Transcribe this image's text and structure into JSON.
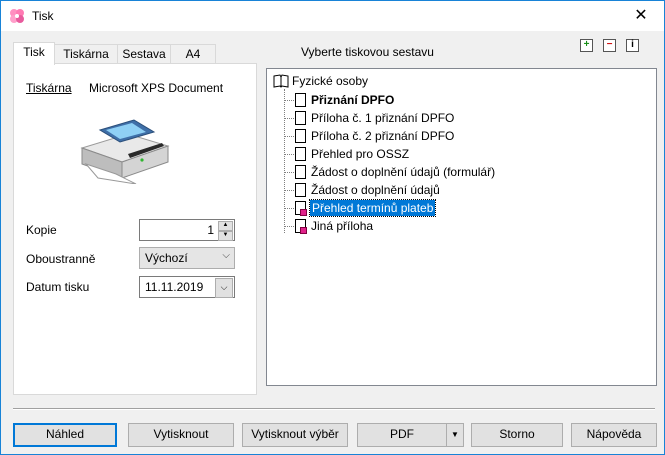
{
  "window": {
    "title": "Tisk",
    "close_glyph": "✕"
  },
  "tabs": [
    {
      "label": "Tisk",
      "active": true
    },
    {
      "label": "Tiskárna",
      "active": false
    },
    {
      "label": "Sestava",
      "active": false
    },
    {
      "label": "A4",
      "active": false
    }
  ],
  "print_panel": {
    "printer_label": "Tiskárna",
    "printer_name": "Microsoft XPS Document",
    "copies_label": "Kopie",
    "copies_value": "1",
    "duplex_label": "Oboustranně",
    "duplex_value": "Výchozí",
    "date_label": "Datum tisku",
    "date_value": "11.11.2019"
  },
  "report": {
    "title": "Vyberte tiskovou sestavu",
    "toolbar": [
      "add-icon",
      "remove-icon",
      "info-icon"
    ],
    "root": "Fyzické osoby",
    "items": [
      {
        "label": "Přiznání DPFO",
        "bold": true,
        "icon": "document-icon",
        "selected": false
      },
      {
        "label": "Příloha č. 1 přiznání DPFO",
        "bold": false,
        "icon": "document-icon",
        "selected": false
      },
      {
        "label": "Příloha č. 2 přiznání DPFO",
        "bold": false,
        "icon": "document-icon",
        "selected": false
      },
      {
        "label": "Přehled pro OSSZ",
        "bold": false,
        "icon": "document-icon",
        "selected": false
      },
      {
        "label": "Žádost o doplnění údajů (formulář)",
        "bold": false,
        "icon": "document-icon",
        "selected": false
      },
      {
        "label": "Žádost o doplnění údajů",
        "bold": false,
        "icon": "document-icon",
        "selected": false
      },
      {
        "label": "Přehled termínů plateb",
        "bold": false,
        "icon": "custom-document-icon",
        "selected": true
      },
      {
        "label": "Jiná příloha",
        "bold": false,
        "icon": "custom-document-icon",
        "selected": false
      }
    ]
  },
  "buttons": {
    "preview": "Náhled",
    "print": "Vytisknout",
    "print_selection": "Vytisknout výběr",
    "pdf": "PDF",
    "cancel": "Storno",
    "help": "Nápověda"
  },
  "colors": {
    "accent": "#0078d7",
    "selection": "#0078d7",
    "custom_report_marker": "#e0218a"
  }
}
